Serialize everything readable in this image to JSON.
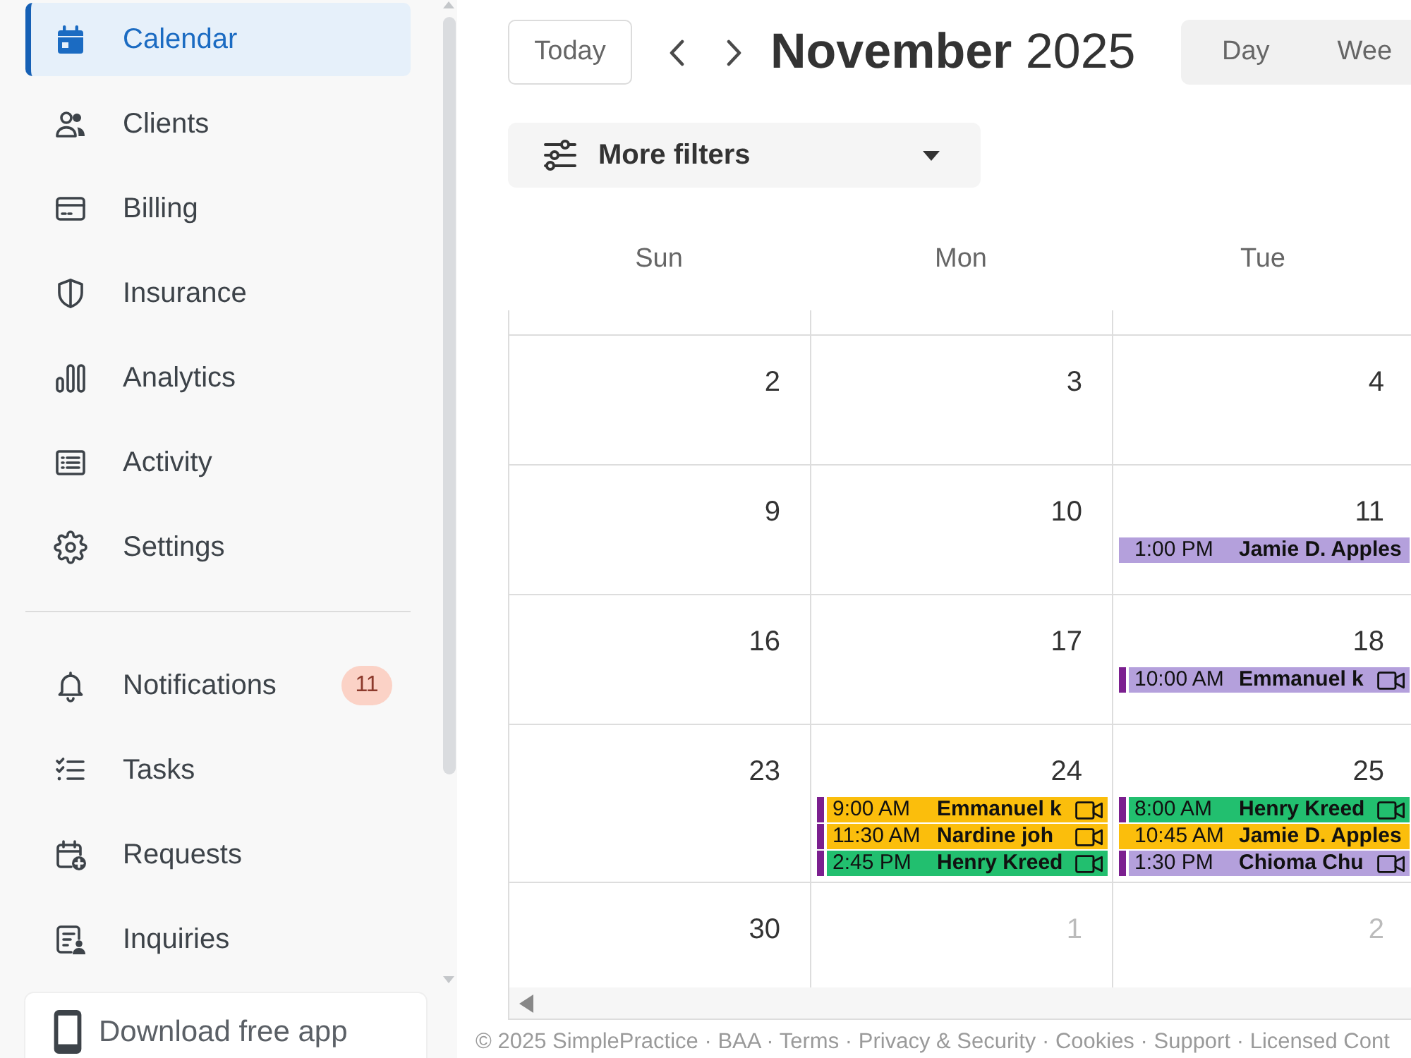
{
  "sidebar": {
    "main_items": [
      {
        "label": "Calendar",
        "selected": true
      },
      {
        "label": "Clients",
        "selected": false
      },
      {
        "label": "Billing",
        "selected": false
      },
      {
        "label": "Insurance",
        "selected": false
      },
      {
        "label": "Analytics",
        "selected": false
      },
      {
        "label": "Activity",
        "selected": false
      },
      {
        "label": "Settings",
        "selected": false
      }
    ],
    "secondary_items": [
      {
        "label": "Notifications",
        "selected": false,
        "badge": "11"
      },
      {
        "label": "Tasks",
        "selected": false
      },
      {
        "label": "Requests",
        "selected": false
      },
      {
        "label": "Inquiries",
        "selected": false
      }
    ],
    "download_button": "Download free app"
  },
  "toolbar": {
    "today_button": "Today",
    "title": "**November** 2025",
    "views": [
      {
        "label": "Day",
        "selected": false
      },
      {
        "label": "Wee",
        "selected": false
      }
    ],
    "filter_button": "More filters"
  },
  "calendar": {
    "weekdays": [
      "Sun",
      "Mon",
      "Tue"
    ],
    "weeks": [
      {
        "days": [
          {
            "day": "2",
            "in_month": true
          },
          {
            "day": "3",
            "in_month": true
          },
          {
            "day": "4",
            "in_month": true
          }
        ]
      },
      {
        "days": [
          {
            "day": "9",
            "in_month": true
          },
          {
            "day": "10",
            "in_month": true
          },
          {
            "day": "11",
            "in_month": true,
            "events": [
              {
                "time": "1:00 PM",
                "client": "Jamie D. Apples",
                "color": "#b4a0dc",
                "flagged": false,
                "video": false
              }
            ]
          }
        ]
      },
      {
        "days": [
          {
            "day": "16",
            "in_month": true
          },
          {
            "day": "17",
            "in_month": true
          },
          {
            "day": "18",
            "in_month": true,
            "events": [
              {
                "time": "10:00 AM",
                "client": "Emmanuel k",
                "color": "#b4a0dc",
                "flagged": true,
                "video": true
              }
            ]
          }
        ]
      },
      {
        "days": [
          {
            "day": "23",
            "in_month": true
          },
          {
            "day": "24",
            "in_month": true,
            "events": [
              {
                "time": "9:00 AM",
                "client": "Emmanuel k",
                "color": "#fbbe0c",
                "flagged": true,
                "video": true
              },
              {
                "time": "11:30 AM",
                "client": "Nardine joh",
                "color": "#fbbe0c",
                "flagged": true,
                "video": true
              },
              {
                "time": "2:45 PM",
                "client": "Henry Kreed",
                "color": "#22bf6f",
                "flagged": true,
                "video": true
              }
            ]
          },
          {
            "day": "25",
            "in_month": true,
            "events": [
              {
                "time": "8:00 AM",
                "client": "Henry Kreed",
                "color": "#22bf6f",
                "flagged": true,
                "video": true
              },
              {
                "time": "10:45 AM",
                "client": "Jamie D. Apples",
                "color": "#fbbe0c",
                "flagged": false,
                "video": false
              },
              {
                "time": "1:30 PM",
                "client": "Chioma Chu",
                "color": "#b4a0dc",
                "flagged": true,
                "video": true
              }
            ]
          }
        ]
      },
      {
        "days": [
          {
            "day": "30",
            "in_month": true
          },
          {
            "day": "1",
            "in_month": false
          },
          {
            "day": "2",
            "in_month": false
          }
        ]
      }
    ]
  },
  "footer": {
    "copyright": "© 2025 SimplePractice",
    "separator": "·",
    "links": [
      "BAA",
      "Terms",
      "Privacy & Security",
      "Cookies",
      "Support",
      "Licensed Cont"
    ]
  }
}
